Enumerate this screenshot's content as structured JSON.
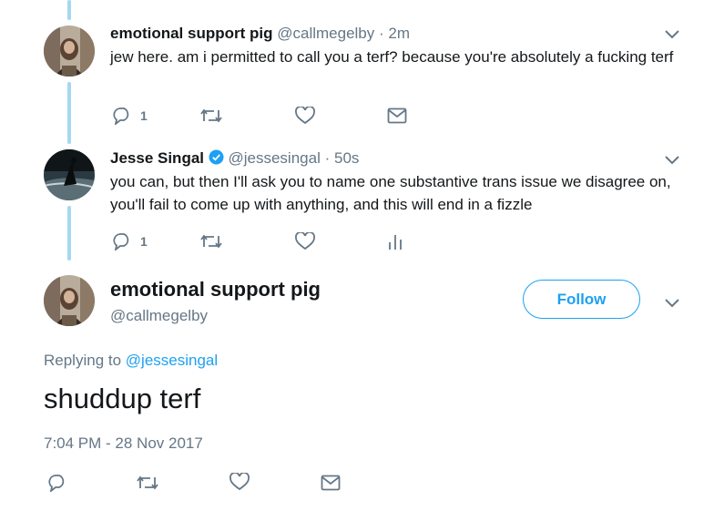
{
  "tweets": [
    {
      "name": "emotional support pig",
      "handle": "@callmegelby",
      "dot": "·",
      "time": "2m",
      "text": "jew here. am i permitted to call you a terf? because you're absolutely a fucking terf",
      "reply_count": "1"
    },
    {
      "name": "Jesse Singal",
      "handle": "@jessesingal",
      "dot": "·",
      "time": "50s",
      "verified": true,
      "text": "you can, but then I'll ask you to name one substantive trans issue we disagree on, you'll fail to come up with anything, and this will end in a fizzle",
      "reply_count": "1"
    }
  ],
  "focus_tweet": {
    "name": "emotional support pig",
    "handle": "@callmegelby",
    "follow_label": "Follow",
    "replying_prefix": "Replying to",
    "replying_to": "@jessesingal",
    "text": "shuddup terf",
    "timestamp": "7:04 PM - 28 Nov 2017"
  },
  "icons": [
    "reply-icon",
    "retweet-icon",
    "like-icon",
    "dm-icon",
    "analytics-icon",
    "chevron-down-icon",
    "verified-badge-icon"
  ],
  "colors": {
    "accent": "#1da1f2",
    "muted": "#657786",
    "thread_line": "#a4d8f0",
    "text": "#14171a"
  }
}
